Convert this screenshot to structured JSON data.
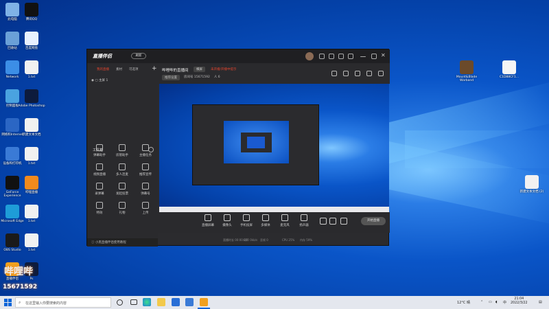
{
  "desktop": {
    "left_icons": [
      {
        "label": "此电脑",
        "color": "#7fb2e6"
      },
      {
        "label": "腾讯QQ",
        "color": "#111"
      },
      {
        "label": "回收站",
        "color": "#6aa0d8"
      },
      {
        "label": "百度网盘",
        "color": "#e8f0ff"
      },
      {
        "label": "Network",
        "color": "#3c8ee6"
      },
      {
        "label": "1.txt",
        "color": "#f1f1f1"
      },
      {
        "label": "控制面板",
        "color": "#4aa3e0"
      },
      {
        "label": "Adobe Photoshop",
        "color": "#0d1b3d"
      },
      {
        "label": "网络和Internet",
        "color": "#2b66c4"
      },
      {
        "label": "新建文本文档",
        "color": "#f1f1f1"
      },
      {
        "label": "设备和打印机",
        "color": "#3a7ad6"
      },
      {
        "label": "1.txt",
        "color": "#f1f1f1"
      },
      {
        "label": "GeForce Experience",
        "color": "#111"
      },
      {
        "label": "哔哩直播",
        "color": "#f28a1e"
      },
      {
        "label": "Microsoft Edge",
        "color": "#1e9cd8"
      },
      {
        "label": "1.txt",
        "color": "#f1f1f1"
      },
      {
        "label": "OBS Studio",
        "color": "#1a1a1a"
      },
      {
        "label": "1.txt",
        "color": "#f1f1f1"
      },
      {
        "label": "直播伴侣",
        "color": "#f0a020"
      },
      {
        "label": "Ps",
        "color": "#0d1b3d"
      }
    ],
    "right_icons": [
      {
        "label": "Mount&Blade Warband",
        "color": "#6b4a2a"
      },
      {
        "label": "C1D88CF1...",
        "color": "#f5f5f5"
      },
      {
        "label": "新建文本文档 (2)",
        "color": "#f1f1f1"
      }
    ],
    "watermark": {
      "text1": "哔哩哔",
      "text2": "15671592"
    }
  },
  "app": {
    "title": "直播伴侣",
    "version": "刷新",
    "sidebar": {
      "tabs": [
        "我的直播",
        "素材",
        "可选项"
      ],
      "scene": "主屏 1",
      "tools_title": "工具箱",
      "tools": [
        "弹幕助手",
        "房管助手",
        "主播任务",
        "视频直播",
        "多人连麦",
        "推荐宣传",
        "录弹幕",
        "发起投票",
        "弹幕号",
        "特效",
        "礼物",
        "上传"
      ],
      "bottom": "小黑直播伴侣使用教程"
    },
    "header": {
      "room": "哔哩哔的直播间",
      "mode_tag": "横屏",
      "warning": "未开播/开播中提示",
      "sub": [
        "推荐设置",
        "房间号 15671592",
        "人 6"
      ]
    },
    "bottom_tools": [
      "直播屏幕",
      "摄像头",
      "手机投屏",
      "多媒体",
      "麦克风",
      "扬声器"
    ],
    "go_live": "开始直播",
    "status": [
      "直播时长 00:00:00",
      "码率 0kb/s",
      "丢帧 0",
      "CPU 25%",
      "内存 59%"
    ]
  },
  "taskbar": {
    "search_placeholder": "在这里输入你要搜索的内容",
    "weather": "12°C 晴",
    "ime": "中",
    "time": "21:04",
    "date": "2022/3/22"
  },
  "colors": {
    "accent": "#e0442e",
    "taskbar": "#e4e7ee"
  }
}
